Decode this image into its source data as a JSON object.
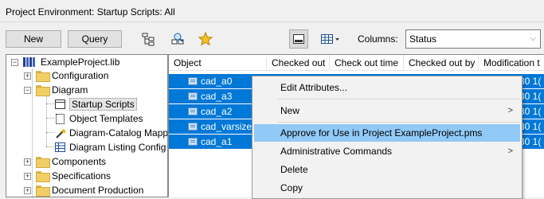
{
  "window": {
    "title": "Project Environment: Startup Scripts: All"
  },
  "toolbar": {
    "new_label": "New",
    "query_label": "Query",
    "columns_label": "Columns:",
    "columns_value": "Status"
  },
  "tree": {
    "root": "ExampleProject.lib",
    "items": {
      "configuration": "Configuration",
      "diagram": "Diagram",
      "startup_scripts": "Startup Scripts",
      "object_templates": "Object Templates",
      "diagram_catalog": "Diagram-Catalog Mapp",
      "diagram_listing": "Diagram Listing Config",
      "components": "Components",
      "specifications": "Specifications",
      "document_production": "Document Production"
    }
  },
  "list": {
    "columns": [
      "Object",
      "Checked out",
      "Check out time",
      "Checked out by",
      "Modification t"
    ],
    "rows": [
      {
        "name": "cad_a0",
        "tail": "30 1("
      },
      {
        "name": "cad_a3",
        "tail": "30 1("
      },
      {
        "name": "cad_a2",
        "tail": "30 1("
      },
      {
        "name": "cad_varsize",
        "tail": "30 1("
      },
      {
        "name": "cad_a1",
        "tail": "30 1("
      }
    ]
  },
  "context_menu": {
    "items": {
      "edit_attributes": "Edit Attributes...",
      "new": "New",
      "approve": "Approve for Use in Project ExampleProject.pms",
      "admin_commands": "Administrative Commands",
      "delete": "Delete",
      "copy": "Copy"
    }
  }
}
